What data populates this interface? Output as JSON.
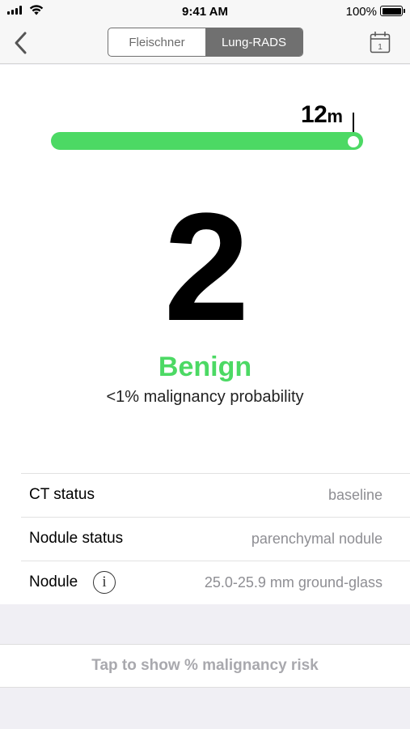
{
  "status_bar": {
    "time": "9:41 AM",
    "battery_percent": "100%",
    "battery_level": 1.0
  },
  "nav": {
    "segments": [
      "Fleischner",
      "Lung-RADS"
    ],
    "selected_segment": "Lung-RADS",
    "back_icon": "chevron-left-icon",
    "calendar_icon": "calendar-icon",
    "calendar_day": "1"
  },
  "followup": {
    "value": "12",
    "unit": "m",
    "slider_fraction": 1.0,
    "accent_color": "#4cd964"
  },
  "result": {
    "category": "2",
    "label": "Benign",
    "probability": "<1% malignancy probability"
  },
  "details": [
    {
      "label": "CT status",
      "value": "baseline"
    },
    {
      "label": "Nodule status",
      "value": "parenchymal nodule"
    },
    {
      "label": "Nodule",
      "value": "25.0-25.9 mm ground-glass",
      "info_icon": "info-icon",
      "info_glyph": "i"
    }
  ],
  "risk_button": {
    "label": "Tap to show % malignancy risk"
  }
}
